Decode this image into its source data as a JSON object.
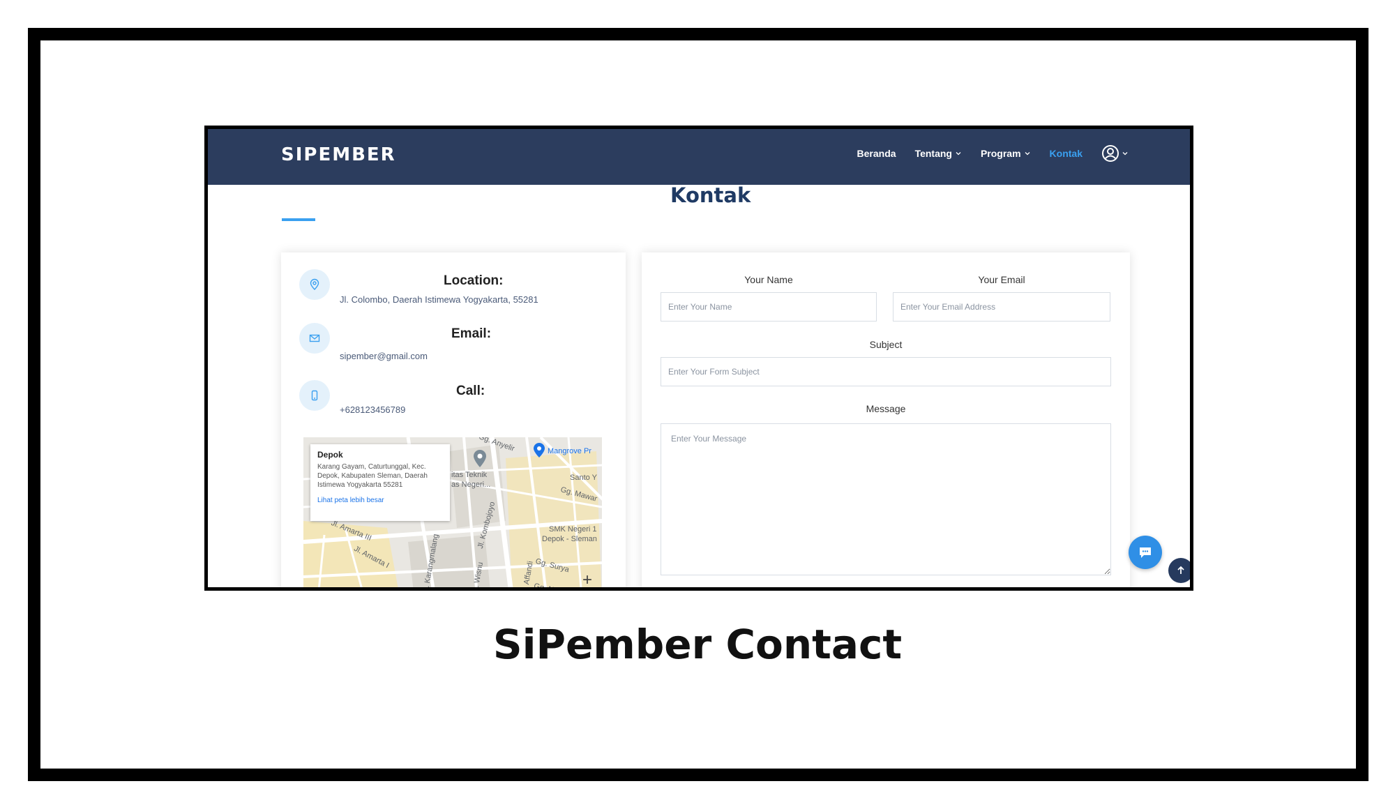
{
  "caption": "SiPember Contact",
  "header": {
    "logo": "SIPEMBER",
    "nav": {
      "beranda": "Beranda",
      "tentang": "Tentang",
      "program": "Program",
      "kontak": "Kontak"
    }
  },
  "page": {
    "title": "Kontak"
  },
  "info": {
    "location": {
      "heading": "Location:",
      "text": "Jl. Colombo, Daerah Istimewa Yogyakarta, 55281"
    },
    "email": {
      "heading": "Email:",
      "text": "sipember@gmail.com"
    },
    "call": {
      "heading": "Call:",
      "text": "+628123456789"
    }
  },
  "map": {
    "popup_title": "Depok",
    "popup_address": "Karang Gayam, Caturtunggal, Kec. Depok, Kabupaten Sleman, Daerah Istimewa Yogyakarta 55281",
    "popup_link": "Lihat peta lebih besar",
    "labels": {
      "anyelir": "Gg. Anyelir",
      "mangrove": "Mangrove Pr",
      "teknik": "itas Teknik",
      "negeri": "as Negeri...",
      "santo": "Santo Y",
      "mawar": "Gg. Mawar",
      "amarta1": "Jl. Amarta III",
      "amarta2": "Jl. Amarta I",
      "kombojoyo": "Jl. Kombojoyo",
      "karangmalang": "Jl. Karangmalang",
      "smk": "SMK Negeri 1",
      "depok_sleman": "Depok - Sleman",
      "gg_surya": "Gg. Surya",
      "afandi": "Jl. Affandi",
      "gg_nara": "Gg. Nara",
      "wisnu": "Jl. Wisnu"
    },
    "zoom": "+"
  },
  "form": {
    "name_label": "Your Name",
    "name_placeholder": "Enter Your Name",
    "email_label": "Your Email",
    "email_placeholder": "Enter Your Email Address",
    "subject_label": "Subject",
    "subject_placeholder": "Enter Your Form Subject",
    "message_label": "Message",
    "message_placeholder": "Enter Your Message"
  },
  "icons": {
    "location": "location-pin-icon",
    "email": "envelope-icon",
    "call": "phone-icon",
    "user": "user-circle-icon",
    "chat": "chat-icon",
    "back_to_top": "arrow-up-icon"
  },
  "colors": {
    "header_bg": "#2c3d5e",
    "accent": "#3aa0f0",
    "title": "#1f3a64",
    "back_to_top_bg": "#263a5e",
    "chat_bg": "#2f8fe6"
  }
}
